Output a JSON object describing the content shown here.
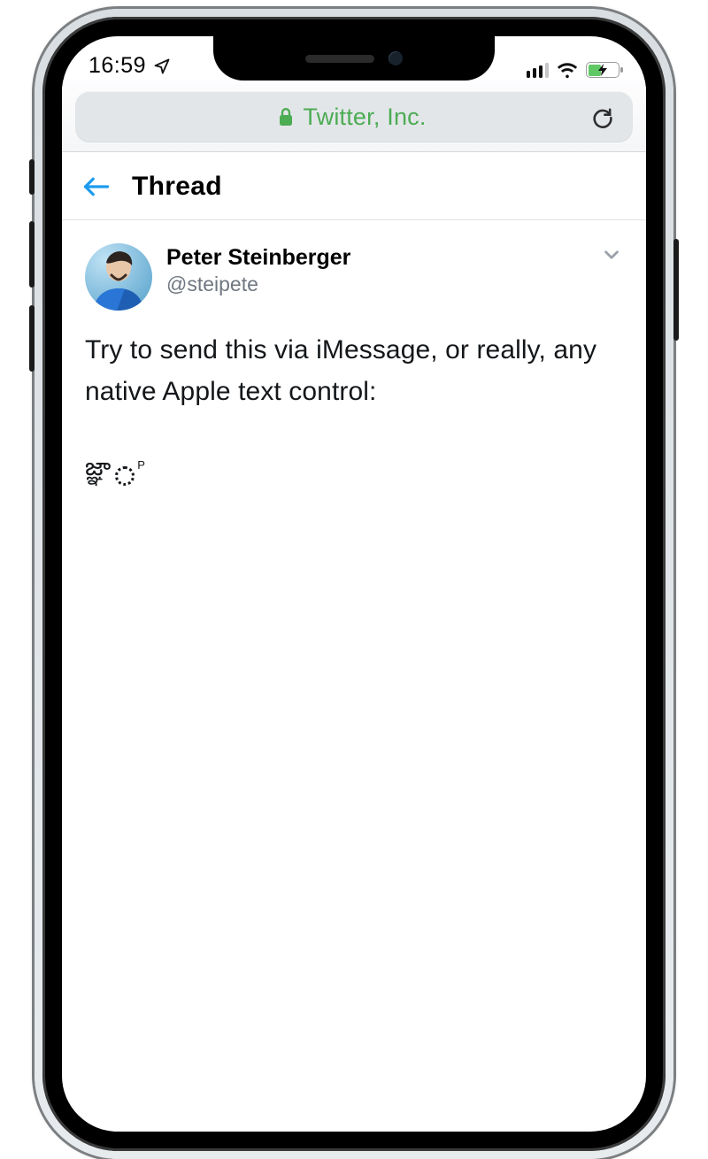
{
  "status": {
    "time": "16:59",
    "location_arrow": "↗"
  },
  "address": {
    "site_label": "Twitter, Inc."
  },
  "header": {
    "title": "Thread"
  },
  "tweet": {
    "author_name": "Peter Steinberger",
    "author_handle": "@steipete",
    "body": "Try to send this via iMessage, or really, any native Apple text control:",
    "special_text": "జ్ఞ‌ా"
  }
}
